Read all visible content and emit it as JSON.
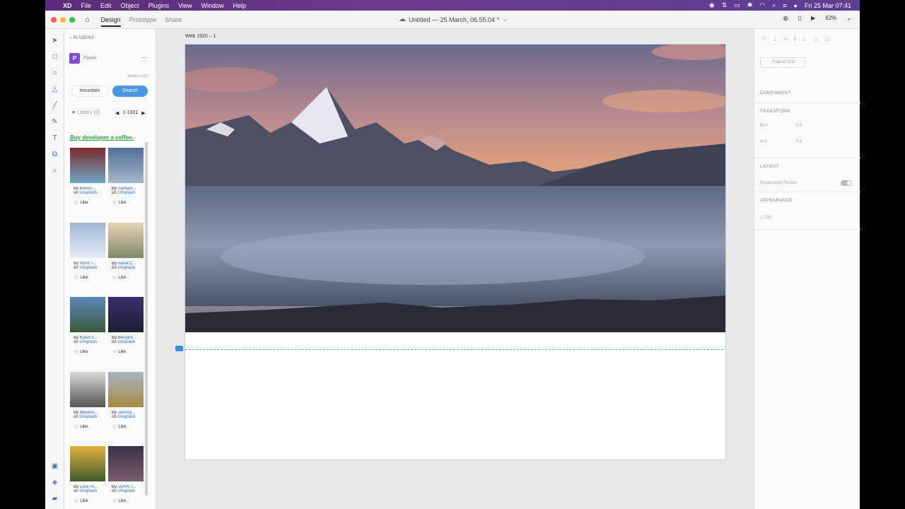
{
  "menubar": {
    "apple": "",
    "app": "XD",
    "items": [
      "File",
      "Edit",
      "Object",
      "Plugins",
      "View",
      "Window",
      "Help"
    ],
    "datetime": "Fri 25 Mar  07:41"
  },
  "titlebar": {
    "tabs": [
      "Design",
      "Prototype",
      "Share"
    ],
    "doc_title": "Untitled — 25 March, 06.55.04 *",
    "zoom": "62%"
  },
  "plugins": {
    "back_label": "PLUGINS",
    "name": "Pixels",
    "version": "Version 1.0.1",
    "search_value": "mountain",
    "search_button": "Search",
    "library": "Library (0)",
    "pager": "1-1001",
    "coffee": "Buy developer a coffee.",
    "on_label": "on",
    "like_label": "Like",
    "cards": [
      {
        "by": "By",
        "author": "Boxed...",
        "source": "Unsplash",
        "colors": [
          "#7a2a2a",
          "#6fa7c8"
        ]
      },
      {
        "by": "By",
        "author": "Samuel...",
        "source": "Unsplash",
        "colors": [
          "#4f6f96",
          "#a7b8cc"
        ]
      },
      {
        "by": "By",
        "author": "Rohit T...",
        "source": "Unsplash",
        "colors": [
          "#9fb6d8",
          "#e6eef7"
        ]
      },
      {
        "by": "By",
        "author": "Ivana C...",
        "source": "Unsplash",
        "colors": [
          "#e8d3b2",
          "#7c8a6a"
        ]
      },
      {
        "by": "By",
        "author": "Kalen E...",
        "source": "Unsplash",
        "colors": [
          "#5b87b9",
          "#3a5a3a"
        ]
      },
      {
        "by": "By",
        "author": "Benjami...",
        "source": "Unsplash",
        "colors": [
          "#3a2f6a",
          "#1a1f35"
        ]
      },
      {
        "by": "By",
        "author": "Massim...",
        "source": "Unsplash",
        "colors": [
          "#d9d9d9",
          "#555"
        ]
      },
      {
        "by": "By",
        "author": "Jeremy...",
        "source": "Unsplash",
        "colors": [
          "#a9b3c2",
          "#a58b3e"
        ]
      },
      {
        "by": "By",
        "author": "Luke Ri...",
        "source": "Unsplash",
        "colors": [
          "#e3b23d",
          "#3f5a2c"
        ]
      },
      {
        "by": "By",
        "author": "JOHN T...",
        "source": "Unsplash",
        "colors": [
          "#3a3048",
          "#7a5e6c"
        ]
      }
    ]
  },
  "canvas": {
    "artboard_label": "Web 1920 – 1"
  },
  "props": {
    "repeat_grid": "Repeat Grid",
    "component": "COMPONENT",
    "transform": "TRANSFORM",
    "w_label": "W",
    "w_value": "0",
    "x_label": "X",
    "x_value": "0",
    "h_label": "H",
    "h_value": "0",
    "y_label": "Y",
    "y_value": "0",
    "layout": "LAYOUT",
    "responsive": "Responsive Resize",
    "appearance": "APPEARANCE",
    "opacity": "0%"
  }
}
